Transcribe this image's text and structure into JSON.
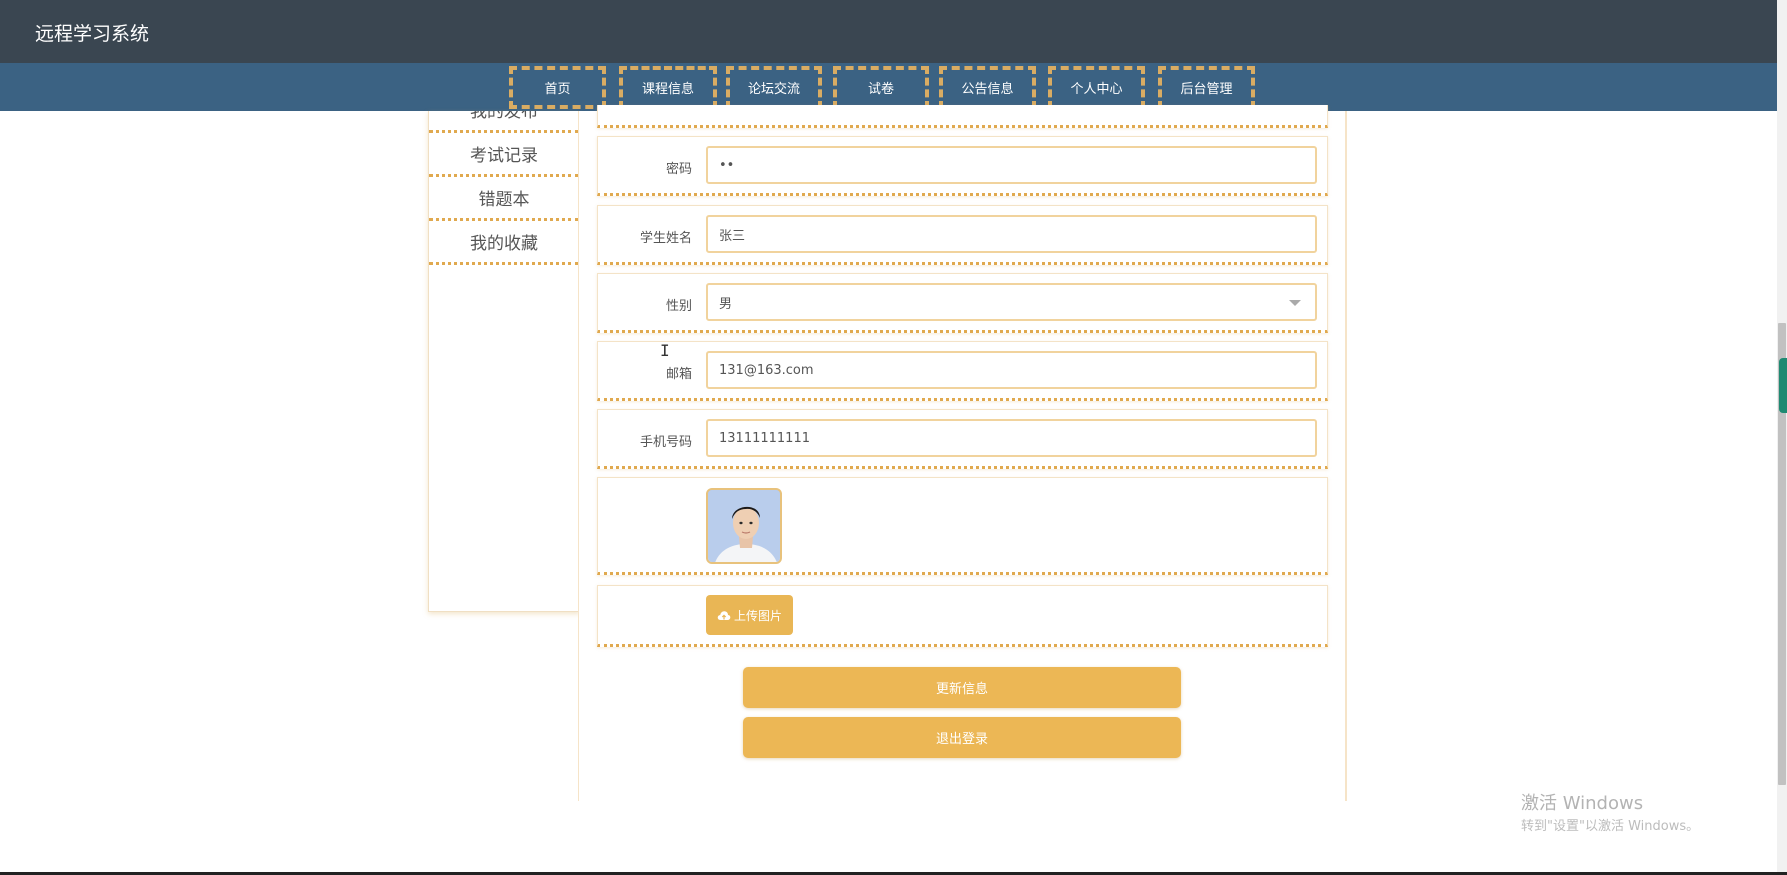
{
  "header": {
    "title": "远程学习系统"
  },
  "nav": {
    "items": [
      {
        "label": "首页"
      },
      {
        "label": "课程信息"
      },
      {
        "label": "论坛交流"
      },
      {
        "label": "试卷"
      },
      {
        "label": "公告信息"
      },
      {
        "label": "个人中心"
      },
      {
        "label": "后台管理"
      }
    ]
  },
  "sidebar": {
    "items": [
      {
        "label": "我的发布"
      },
      {
        "label": "考试记录"
      },
      {
        "label": "错题本"
      },
      {
        "label": "我的收藏"
      }
    ]
  },
  "form": {
    "password": {
      "label": "密码",
      "value": "••"
    },
    "name": {
      "label": "学生姓名",
      "value": "张三"
    },
    "gender": {
      "label": "性别",
      "value": "男"
    },
    "email": {
      "label": "邮箱",
      "value": "131@163.com"
    },
    "phone": {
      "label": "手机号码",
      "value": "13111111111"
    },
    "upload_label": "上传图片"
  },
  "buttons": {
    "update": "更新信息",
    "logout": "退出登录"
  },
  "watermark": {
    "line1": "激活 Windows",
    "line2": "转到\"设置\"以激活 Windows。"
  },
  "colors": {
    "header_bg": "#3a4651",
    "nav_bg": "#3b6283",
    "accent": "#ecb755",
    "dotted_border": "#e0a94f"
  },
  "icons": {
    "upload": "cloud-upload-icon",
    "select": "chevron-down-icon",
    "cursor": "text-cursor-icon"
  }
}
